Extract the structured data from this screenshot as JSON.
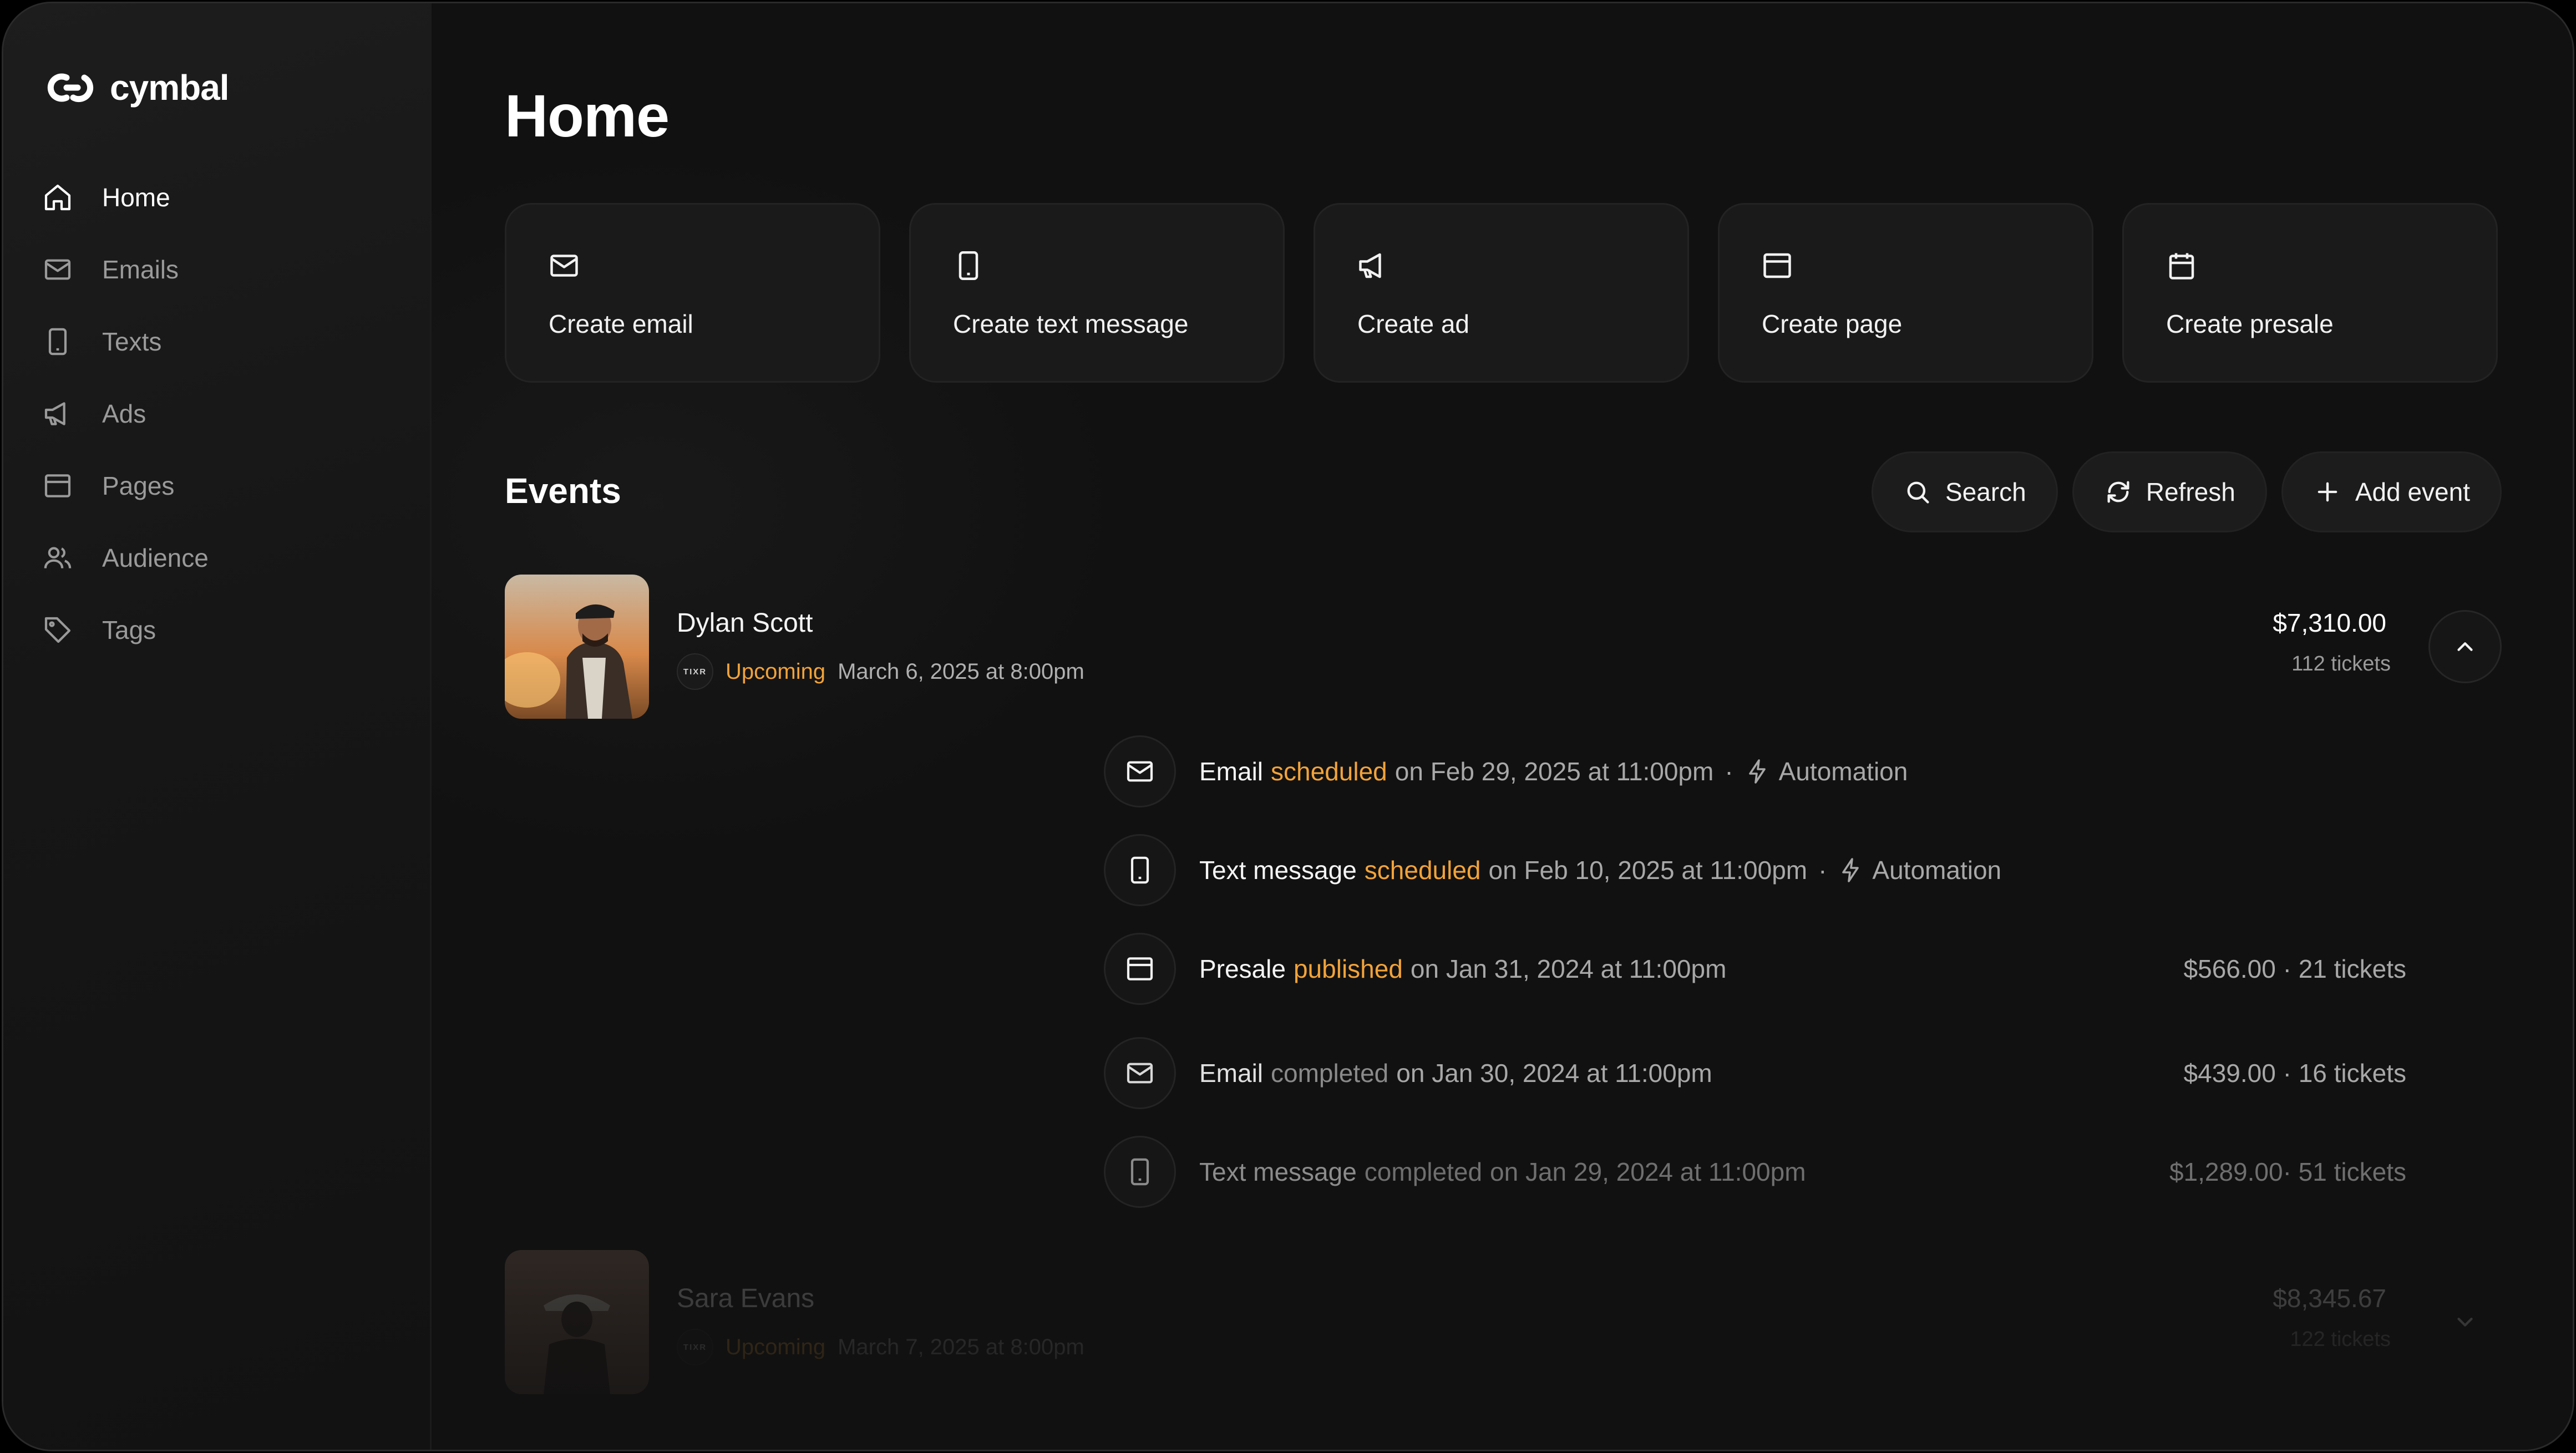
{
  "app": {
    "name": "cymbal"
  },
  "sidebar": {
    "items": [
      {
        "label": "Home",
        "icon": "home-icon",
        "active": true
      },
      {
        "label": "Emails",
        "icon": "mail-icon"
      },
      {
        "label": "Texts",
        "icon": "phone-icon"
      },
      {
        "label": "Ads",
        "icon": "megaphone-icon"
      },
      {
        "label": "Pages",
        "icon": "browser-icon"
      },
      {
        "label": "Audience",
        "icon": "users-icon"
      },
      {
        "label": "Tags",
        "icon": "tag-icon"
      }
    ]
  },
  "page": {
    "title": "Home"
  },
  "quick_actions": [
    {
      "label": "Create email",
      "icon": "mail-icon"
    },
    {
      "label": "Create text message",
      "icon": "phone-icon"
    },
    {
      "label": "Create ad",
      "icon": "megaphone-icon"
    },
    {
      "label": "Create page",
      "icon": "browser-icon"
    },
    {
      "label": "Create presale",
      "icon": "calendar-icon"
    }
  ],
  "events_section": {
    "title": "Events",
    "search_label": "Search",
    "refresh_label": "Refresh",
    "add_label": "Add event"
  },
  "events": [
    {
      "name": "Dylan Scott",
      "source": "TIXR",
      "status": "Upcoming",
      "date": "March 6, 2025 at 8:00pm",
      "amount": "$7,310.00",
      "tickets": "112 tickets",
      "activities": [
        {
          "type": "Email",
          "state": "scheduled",
          "when": "on Feb 29, 2025 at 11:00pm",
          "tag": "Automation",
          "right": ""
        },
        {
          "type": "Text message",
          "state": "scheduled",
          "when": "on Feb 10, 2025 at 11:00pm",
          "tag": "Automation",
          "right": ""
        },
        {
          "type": "Presale",
          "state": "published",
          "when": "on Jan 31, 2024 at 11:00pm",
          "tag": "",
          "right": "$566.00 · 21 tickets"
        },
        {
          "type": "Email",
          "state": "completed",
          "when": "on Jan 30, 2024 at 11:00pm",
          "tag": "",
          "right": "$439.00 · 16 tickets"
        },
        {
          "type": "Text message",
          "state": "completed",
          "when": "on Jan 29, 2024 at 11:00pm",
          "tag": "",
          "right": "$1,289.00· 51 tickets"
        }
      ]
    },
    {
      "name": "Sara Evans",
      "source": "TIXR",
      "status": "Upcoming",
      "date": "March 7, 2025 at 8:00pm",
      "amount": "$8,345.67",
      "tickets": "122 tickets"
    }
  ],
  "colors": {
    "accent": "#f2a33a",
    "background": "#111111",
    "card": "#1a1a1a"
  }
}
